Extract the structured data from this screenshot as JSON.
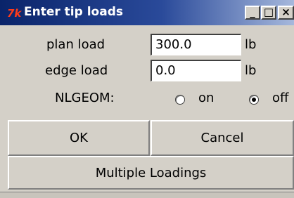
{
  "window": {
    "title": "Enter tip loads",
    "icon": "tk-app-icon",
    "controls": {
      "minimize": "_",
      "maximize": "□",
      "close": "×"
    }
  },
  "form": {
    "plan_load": {
      "label": "plan load",
      "value": "300.0",
      "unit": "lb"
    },
    "edge_load": {
      "label": "edge load",
      "value": "0.0",
      "unit": "lb"
    },
    "nlgeom": {
      "label": "NLGEOM:",
      "options": [
        {
          "label": "on",
          "selected": false
        },
        {
          "label": "off",
          "selected": true
        }
      ]
    }
  },
  "buttons": {
    "ok": "OK",
    "cancel": "Cancel",
    "multiple_loadings": "Multiple Loadings"
  },
  "colors": {
    "titlebar_start": "#0a246a",
    "titlebar_end": "#a6b8dc",
    "face": "#d4d0c8",
    "icon_accent": "#ff3b1a"
  }
}
